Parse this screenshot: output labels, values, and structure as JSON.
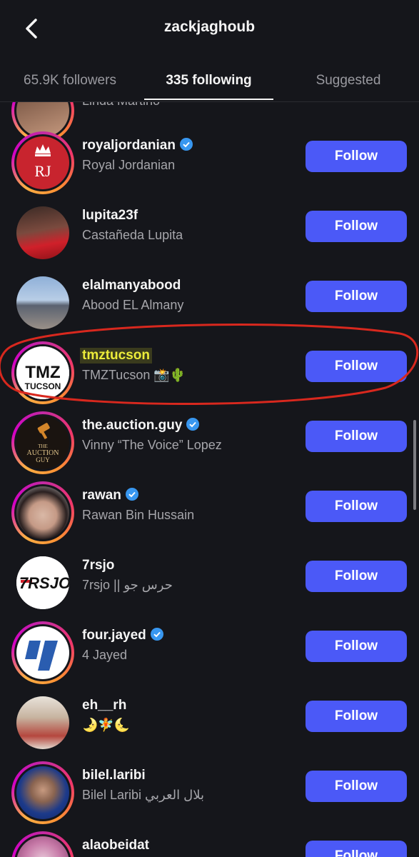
{
  "header": {
    "title": "zackjaghoub",
    "back_icon": "chevron-left-icon"
  },
  "tabs": [
    {
      "label": "65.9K followers",
      "active": false
    },
    {
      "label": "335 following",
      "active": true
    },
    {
      "label": "Suggested",
      "active": false
    }
  ],
  "partial_top": {
    "fullname": "Linda Martino"
  },
  "rows": [
    {
      "username": "royaljordanian",
      "fullname": "Royal Jordanian",
      "verified": true,
      "button": "Follow"
    },
    {
      "username": "lupita23f",
      "fullname": "Castañeda Lupita",
      "verified": false,
      "button": "Follow"
    },
    {
      "username": "elalmanyabood",
      "fullname": "Abood EL Almany",
      "verified": false,
      "button": "Follow"
    },
    {
      "username": "tmztucson",
      "fullname": "TMZTucson 📸🌵",
      "verified": false,
      "button": "Follow"
    },
    {
      "username": "the.auction.guy",
      "fullname": "Vinny “The Voice” Lopez",
      "verified": true,
      "button": "Follow"
    },
    {
      "username": "rawan",
      "fullname": "Rawan Bin Hussain",
      "verified": true,
      "button": "Follow"
    },
    {
      "username": "7rsjo",
      "fullname": "7rsjo || حرس جو",
      "verified": false,
      "button": "Follow"
    },
    {
      "username": "four.jayed",
      "fullname": "4 Jayed",
      "verified": true,
      "button": "Follow"
    },
    {
      "username": "eh__rh",
      "fullname": "🌛🧚🌜",
      "verified": false,
      "button": "Follow"
    },
    {
      "username": "bilel.laribi",
      "fullname": "Bilel Laribi بلال العربي",
      "verified": false,
      "button": "Follow"
    },
    {
      "username": "alaobeidat",
      "fullname": "",
      "verified": false,
      "button": "Follow"
    }
  ],
  "avatars": {
    "royaljordanian": {
      "text": "RJ",
      "bg": "#c8242e"
    },
    "tmztucson": {
      "text1": "TMZ",
      "text2": "TUCSON"
    },
    "auction": {
      "text1": "THE",
      "text2": "AUCTION",
      "text3": "GUY"
    },
    "rsjo": {
      "text": "7RSJO"
    }
  },
  "colors": {
    "follow_button": "#4b59f7",
    "background": "#15161b",
    "verified": "#3897f0",
    "highlight": "#ecec3a",
    "annotation_oval": "#d8281e"
  }
}
